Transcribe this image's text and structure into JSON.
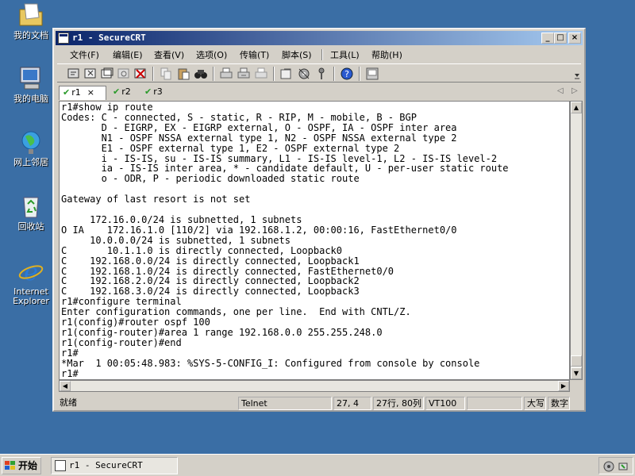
{
  "desktop": {
    "icons": [
      {
        "label": "我的文档",
        "icon": "folder-icon"
      },
      {
        "label": "我的电脑",
        "icon": "computer-icon"
      },
      {
        "label": "网上邻居",
        "icon": "network-icon"
      },
      {
        "label": "回收站",
        "icon": "recycle-bin-icon"
      },
      {
        "label": "Internet Explorer",
        "icon": "ie-icon"
      }
    ]
  },
  "window": {
    "title": "r1 - SecureCRT",
    "controls": {
      "minimize": "_",
      "maximize": "□",
      "close": "×"
    },
    "menu": [
      "文件(F)",
      "编辑(E)",
      "查看(V)",
      "选项(O)",
      "传输(T)",
      "脚本(S)",
      "工具(L)",
      "帮助(H)"
    ],
    "tabs": [
      {
        "label": "r1",
        "active": true,
        "close": "×"
      },
      {
        "label": "r2",
        "active": false
      },
      {
        "label": "r3",
        "active": false
      }
    ],
    "tab_nav": {
      "left": "◁",
      "right": "▷"
    },
    "terminal_text": "r1#show ip route\nCodes: C - connected, S - static, R - RIP, M - mobile, B - BGP\n       D - EIGRP, EX - EIGRP external, O - OSPF, IA - OSPF inter area\n       N1 - OSPF NSSA external type 1, N2 - OSPF NSSA external type 2\n       E1 - OSPF external type 1, E2 - OSPF external type 2\n       i - IS-IS, su - IS-IS summary, L1 - IS-IS level-1, L2 - IS-IS level-2\n       ia - IS-IS inter area, * - candidate default, U - per-user static route\n       o - ODR, P - periodic downloaded static route\n\nGateway of last resort is not set\n\n     172.16.0.0/24 is subnetted, 1 subnets\nO IA    172.16.1.0 [110/2] via 192.168.1.2, 00:00:16, FastEthernet0/0\n     10.0.0.0/24 is subnetted, 1 subnets\nC       10.1.1.0 is directly connected, Loopback0\nC    192.168.0.0/24 is directly connected, Loopback1\nC    192.168.1.0/24 is directly connected, FastEthernet0/0\nC    192.168.2.0/24 is directly connected, Loopback2\nC    192.168.3.0/24 is directly connected, Loopback3\nr1#configure terminal\nEnter configuration commands, one per line.  End with CNTL/Z.\nr1(config)#router ospf 100\nr1(config-router)#area 1 range 192.168.0.0 255.255.248.0\nr1(config-router)#end\nr1#\n*Mar  1 00:05:48.983: %SYS-5-CONFIG_I: Configured from console by console\nr1#",
    "status": {
      "ready": "就绪",
      "protocol": "Telnet",
      "cursor": "27,  4",
      "size": "27行, 80列",
      "terminal": "VT100",
      "empty": "",
      "caps": "大写",
      "num": "数字"
    }
  },
  "taskbar": {
    "start_label": "开始",
    "items": [
      {
        "label": "r1 - SecureCRT"
      }
    ]
  }
}
